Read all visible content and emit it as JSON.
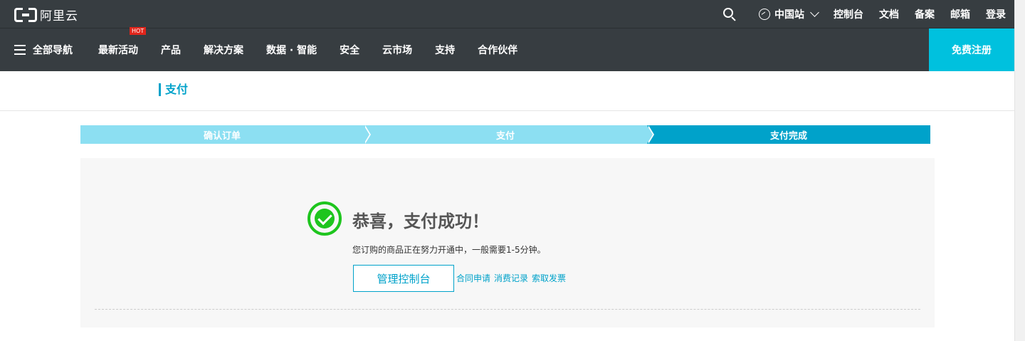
{
  "header": {
    "logo_text": "阿里云",
    "region": "中国站",
    "links": [
      "控制台",
      "文档",
      "备案",
      "邮箱",
      "登录"
    ]
  },
  "nav": {
    "all_label": "全部导航",
    "items": [
      {
        "label": "最新活动",
        "badge": "HOT"
      },
      {
        "label": "产品"
      },
      {
        "label": "解决方案"
      },
      {
        "label": "数据 · 智能"
      },
      {
        "label": "安全"
      },
      {
        "label": "云市场"
      },
      {
        "label": "支持"
      },
      {
        "label": "合作伙伴"
      }
    ],
    "signup_label": "免费注册"
  },
  "page": {
    "title": "支付"
  },
  "steps": [
    {
      "label": "确认订单",
      "state": "done"
    },
    {
      "label": "支付",
      "state": "done"
    },
    {
      "label": "支付完成",
      "state": "active"
    }
  ],
  "result": {
    "title": "恭喜，支付成功！",
    "description": "您订购的商品正在努力开通中，一般需要1-5分钟。",
    "console_button": "管理控制台",
    "links": [
      "合同申请",
      "消费记录",
      "索取发票"
    ]
  },
  "colors": {
    "header_bg": "#373d41",
    "accent": "#00a2ca",
    "signup_bg": "#00c1de",
    "success": "#1ec51e",
    "step_done": "#8cdff2",
    "hot_badge": "#e1251b"
  },
  "icons": [
    "aliyun-logo",
    "search-icon",
    "globe-icon",
    "chevron-down-icon",
    "menu-icon",
    "check-circle-icon"
  ]
}
